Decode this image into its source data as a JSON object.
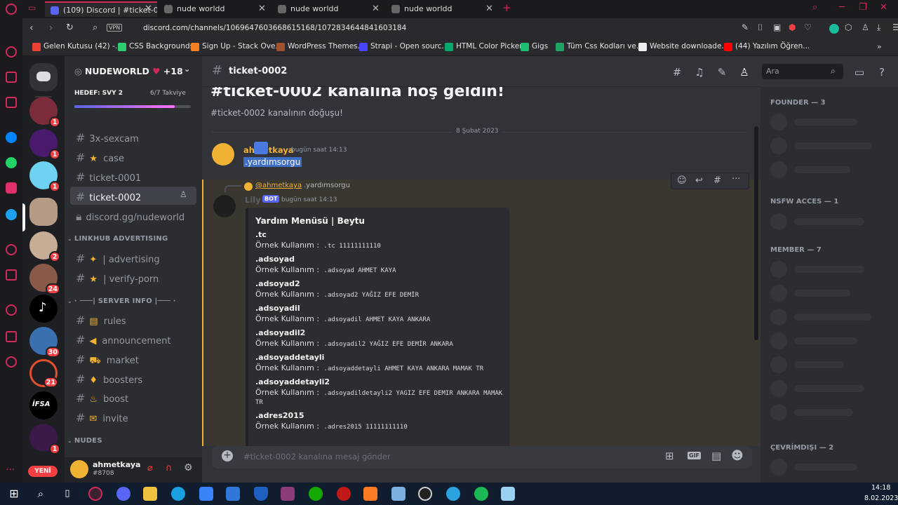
{
  "browser": {
    "tabs": [
      {
        "label": "(109) Discord | #ticket-0",
        "badge": "109"
      },
      {
        "label": "nude worldd"
      },
      {
        "label": "nude worldd"
      },
      {
        "label": "nude worldd"
      }
    ],
    "url": "discord.com/channels/1069647603668615168/1072834644841603184",
    "vpn": "VPN",
    "bookmarks": [
      "Gelen Kutusu (42) -...",
      "CSS Backgrounds",
      "Sign Up - Stack Ove...",
      "WordPress Themes...",
      "Strapi - Open sourc...",
      "HTML Color Picker",
      "Gigs",
      "Tüm Css Kodları ve...",
      "Website downloade...",
      "(44) Yazılım Öğren..."
    ]
  },
  "colors": {
    "accent": "#5865f2",
    "danger": "#f23f43",
    "opera": "#d2285a",
    "brand_yellow": "#f0b232",
    "bot": "#5865f2"
  },
  "guilds": [
    {
      "badge": "1"
    },
    {
      "badge": "1"
    },
    {
      "badge": "1"
    },
    {
      "badge": ""
    },
    {
      "badge": "2"
    },
    {
      "badge": "24"
    },
    {
      "badge": ""
    },
    {
      "badge": "30"
    },
    {
      "badge": "21"
    },
    {
      "badge": ""
    },
    {
      "badge": "1"
    }
  ],
  "guild_labels": {
    "ifsa": "İFSA",
    "yeni": "YENİ"
  },
  "server": {
    "name": "NUDEWORLD",
    "plus": "+18",
    "goal": "HEDEF: SVY 2",
    "boost": "6/7 Takviye",
    "boost_fraction": 0.86
  },
  "channels": [
    {
      "type": "ch",
      "label": "3x-sexcam"
    },
    {
      "type": "ch",
      "emoji": "★",
      "label": "case"
    },
    {
      "type": "ch",
      "label": "ticket-0001"
    },
    {
      "type": "ch",
      "label": "ticket-0002",
      "selected": true
    },
    {
      "type": "lock",
      "label": "discord.gg/nudeworld"
    },
    {
      "type": "cat",
      "label": "LINKHUB ADVERTISING"
    },
    {
      "type": "ch",
      "emoji": "✦",
      "label": "| advertising"
    },
    {
      "type": "ch",
      "emoji": "★",
      "label": "| verify-porn"
    },
    {
      "type": "cat",
      "label": "· ───| SERVER INFO |─── ·"
    },
    {
      "type": "ch",
      "emoji": "▤",
      "label": "rules"
    },
    {
      "type": "ch",
      "emoji": "◀",
      "label": "announcement"
    },
    {
      "type": "ch",
      "emoji": "⛟",
      "label": "market"
    },
    {
      "type": "ch",
      "emoji": "♦",
      "label": "boosters"
    },
    {
      "type": "ch",
      "emoji": "♨",
      "label": "boost"
    },
    {
      "type": "ch",
      "emoji": "✉",
      "label": "invite"
    },
    {
      "type": "cat",
      "label": "NUDES"
    }
  ],
  "user": {
    "name": "ahmetkaya",
    "tag": "#8708"
  },
  "header": {
    "channel": "ticket-0002",
    "search_placeholder": "Ara"
  },
  "chat": {
    "welcome": "#ticket-0002 kanalına hoş geldin!",
    "sub": "#ticket-0002 kanalının doğuşu!",
    "date": "8 Şubat 2023",
    "msg1": {
      "author": "ahmetkaya",
      "time": "bugün saat 14:13",
      "text": ".yardımsorgu"
    },
    "msg2": {
      "reply_author": "@ahmetkaya",
      "reply_text": ".yardımsorgu",
      "author": "Lily",
      "bot": "BOT",
      "time": "bugün saat 14:13",
      "embed_title": "Yardım Menüsü | Beytu",
      "usage_label": "Örnek Kullanım :",
      "items": [
        {
          "cmd": ".tc",
          "ex": ".tc 11111111110"
        },
        {
          "cmd": ".adsoyad",
          "ex": ".adsoyad AHMET KAYA"
        },
        {
          "cmd": ".adsoyad2",
          "ex": ".adsoyad2 YAĞIZ EFE DEMİR"
        },
        {
          "cmd": ".adsoyadil",
          "ex": ".adsoyadil AHMET KAYA ANKARA"
        },
        {
          "cmd": ".adsoyadil2",
          "ex": ".adsoyadil2 YAĞIZ EFE DEMİR ANKARA"
        },
        {
          "cmd": ".adsoyaddetayli",
          "ex": ".adsoyaddetayli AHMET KAYA ANKARA MAMAK TR"
        },
        {
          "cmd": ".adsoyaddetayli2",
          "ex": ".adsoyadildetayli2 YAGIZ EFE DEMIR ANKARA MAMAK TR"
        },
        {
          "cmd": ".adres2015",
          "ex": ".adres2015 11111111110"
        }
      ]
    }
  },
  "composer": {
    "placeholder": "#ticket-0002 kanalına mesaj gönder",
    "gif": "GIF"
  },
  "members": {
    "cats": [
      "FOUNDER — 3",
      "NSFW ACCES — 1",
      "MEMBER — 7",
      "ÇEVRİMDIŞI — 2"
    ]
  },
  "taskbar": {
    "time": "14:18",
    "date": "8.02.2023"
  }
}
